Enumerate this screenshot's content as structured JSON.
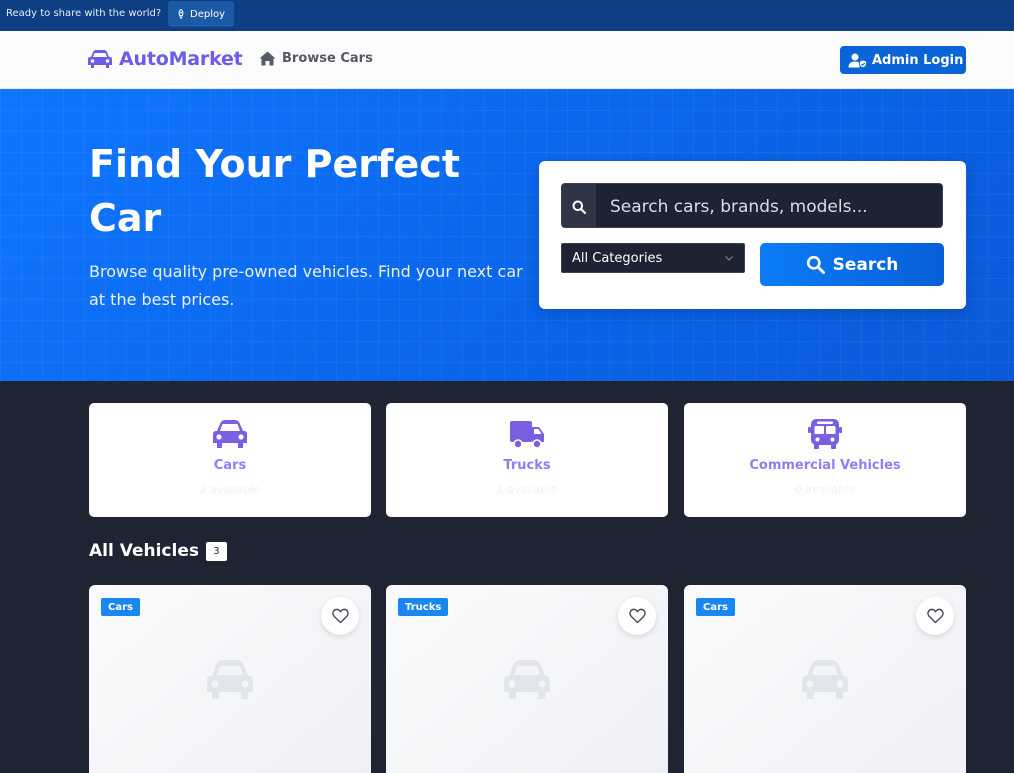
{
  "topbar": {
    "ready_text": "Ready to share with the world?",
    "deploy_label": "Deploy"
  },
  "nav": {
    "brand": "AutoMarket",
    "browse_label": "Browse Cars",
    "admin_label": "Admin Login"
  },
  "hero": {
    "title": "Find Your Perfect Car",
    "subtitle": "Browse quality pre-owned vehicles. Find your next car at the best prices."
  },
  "search": {
    "placeholder": "Search cars, brands, models...",
    "category_value": "All Categories",
    "button_label": "Search"
  },
  "categories": [
    {
      "name": "Cars",
      "count": "2 available",
      "icon": "car-icon"
    },
    {
      "name": "Trucks",
      "count": "1 available",
      "icon": "truck-icon"
    },
    {
      "name": "Commercial Vehicles",
      "count": "0 available",
      "icon": "bus-icon"
    }
  ],
  "section": {
    "title": "All Vehicles",
    "count": "3"
  },
  "vehicles": [
    {
      "category": "Cars"
    },
    {
      "category": "Trucks"
    },
    {
      "category": "Cars"
    }
  ],
  "colors": {
    "brand": "#6c5ce7",
    "primary": "#0b63d8",
    "dark_bg": "#1f2433",
    "tag": "#1a86f0"
  }
}
